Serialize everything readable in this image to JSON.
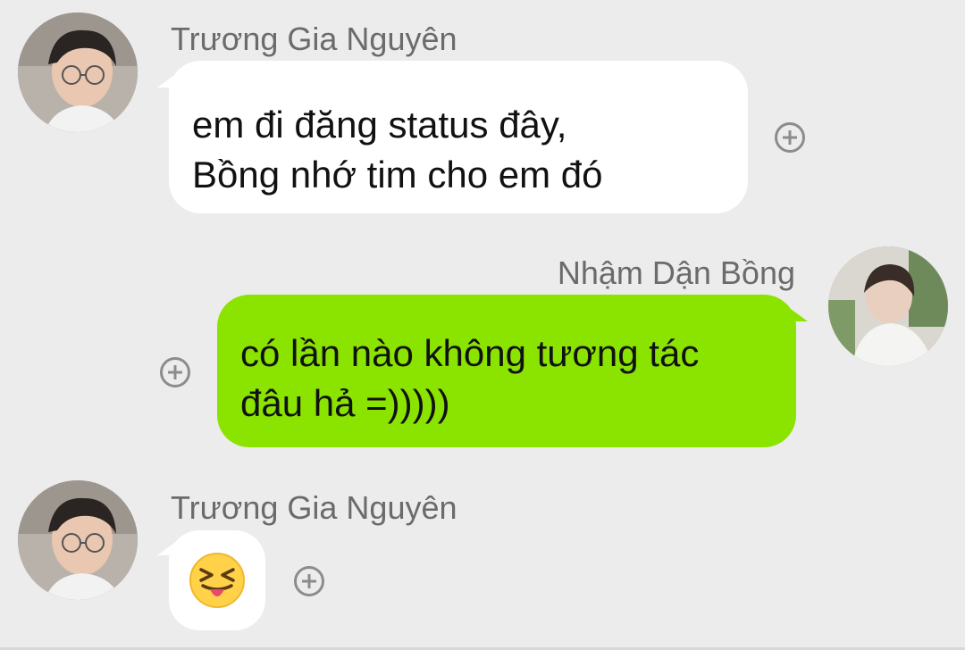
{
  "conversation": {
    "messages": [
      {
        "sender": "Trương Gia Nguyên",
        "direction": "incoming",
        "lines": [
          "em đi đăng status đây,",
          "Bồng nhớ tim cho em đó"
        ],
        "avatar_icon": "avatar-boy-glasses"
      },
      {
        "sender": "Nhậm Dận Bồng",
        "direction": "outgoing",
        "lines": [
          "có lần nào không tương tác",
          "đâu hả =)))))"
        ],
        "avatar_icon": "avatar-boy-sitting"
      },
      {
        "sender": "Trương Gia Nguyên",
        "direction": "incoming",
        "sticker_icon": "squinting-tongue-face-emoji",
        "avatar_icon": "avatar-boy-glasses"
      }
    ],
    "react_icon": "add-reaction-icon"
  },
  "colors": {
    "background": "#ececec",
    "incoming_bubble": "#ffffff",
    "outgoing_bubble": "#8be400",
    "sender_name": "#6b6b6b",
    "message_text": "#111111"
  }
}
